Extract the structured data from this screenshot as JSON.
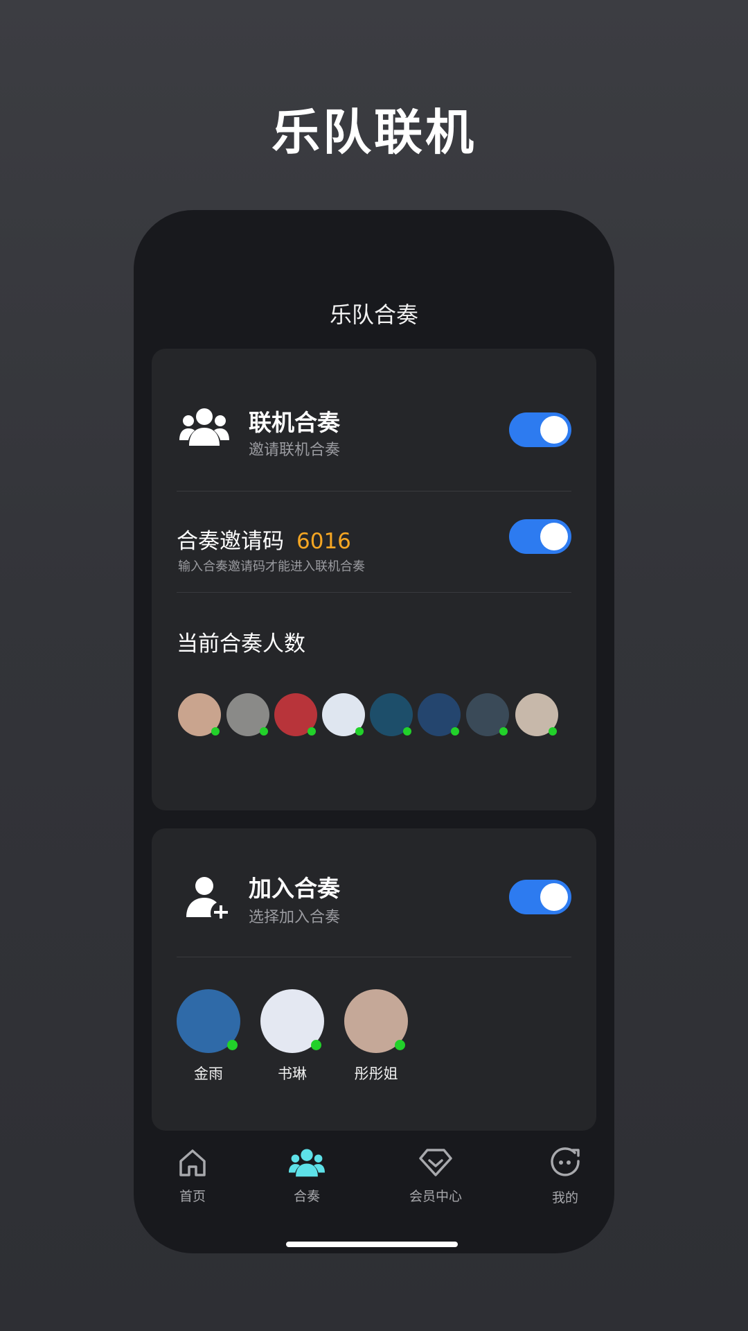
{
  "headline": "乐队联机",
  "screen_title": "乐队合奏",
  "online": {
    "title": "联机合奏",
    "subtitle": "邀请联机合奏",
    "toggle_on": true
  },
  "invite": {
    "label": "合奏邀请码",
    "code": "6016",
    "hint": "输入合奏邀请码才能进入联机合奏",
    "toggle_on": true
  },
  "current": {
    "label": "当前合奏人数",
    "avatar_colors": [
      "#c9a48e",
      "#8a8a88",
      "#b8343a",
      "#dfe6f0",
      "#1d4e6a",
      "#24456e",
      "#3a4a58",
      "#c7b8aa"
    ]
  },
  "join": {
    "title": "加入合奏",
    "subtitle": "选择加入合奏",
    "toggle_on": true,
    "members": [
      {
        "name": "金雨",
        "color": "#2f6aa8"
      },
      {
        "name": "书琳",
        "color": "#e4e8f2"
      },
      {
        "name": "彤彤姐",
        "color": "#c5a898"
      }
    ]
  },
  "tabs": [
    {
      "label": "首页",
      "icon": "home-icon"
    },
    {
      "label": "合奏",
      "icon": "people-icon"
    },
    {
      "label": "会员中心",
      "icon": "vip-icon"
    },
    {
      "label": "我的",
      "icon": "face-icon"
    }
  ],
  "colors": {
    "accent_blue": "#2d7bf0",
    "code_orange": "#f5a623",
    "active_cyan": "#5ee1e8",
    "online_green": "#22d12a"
  }
}
